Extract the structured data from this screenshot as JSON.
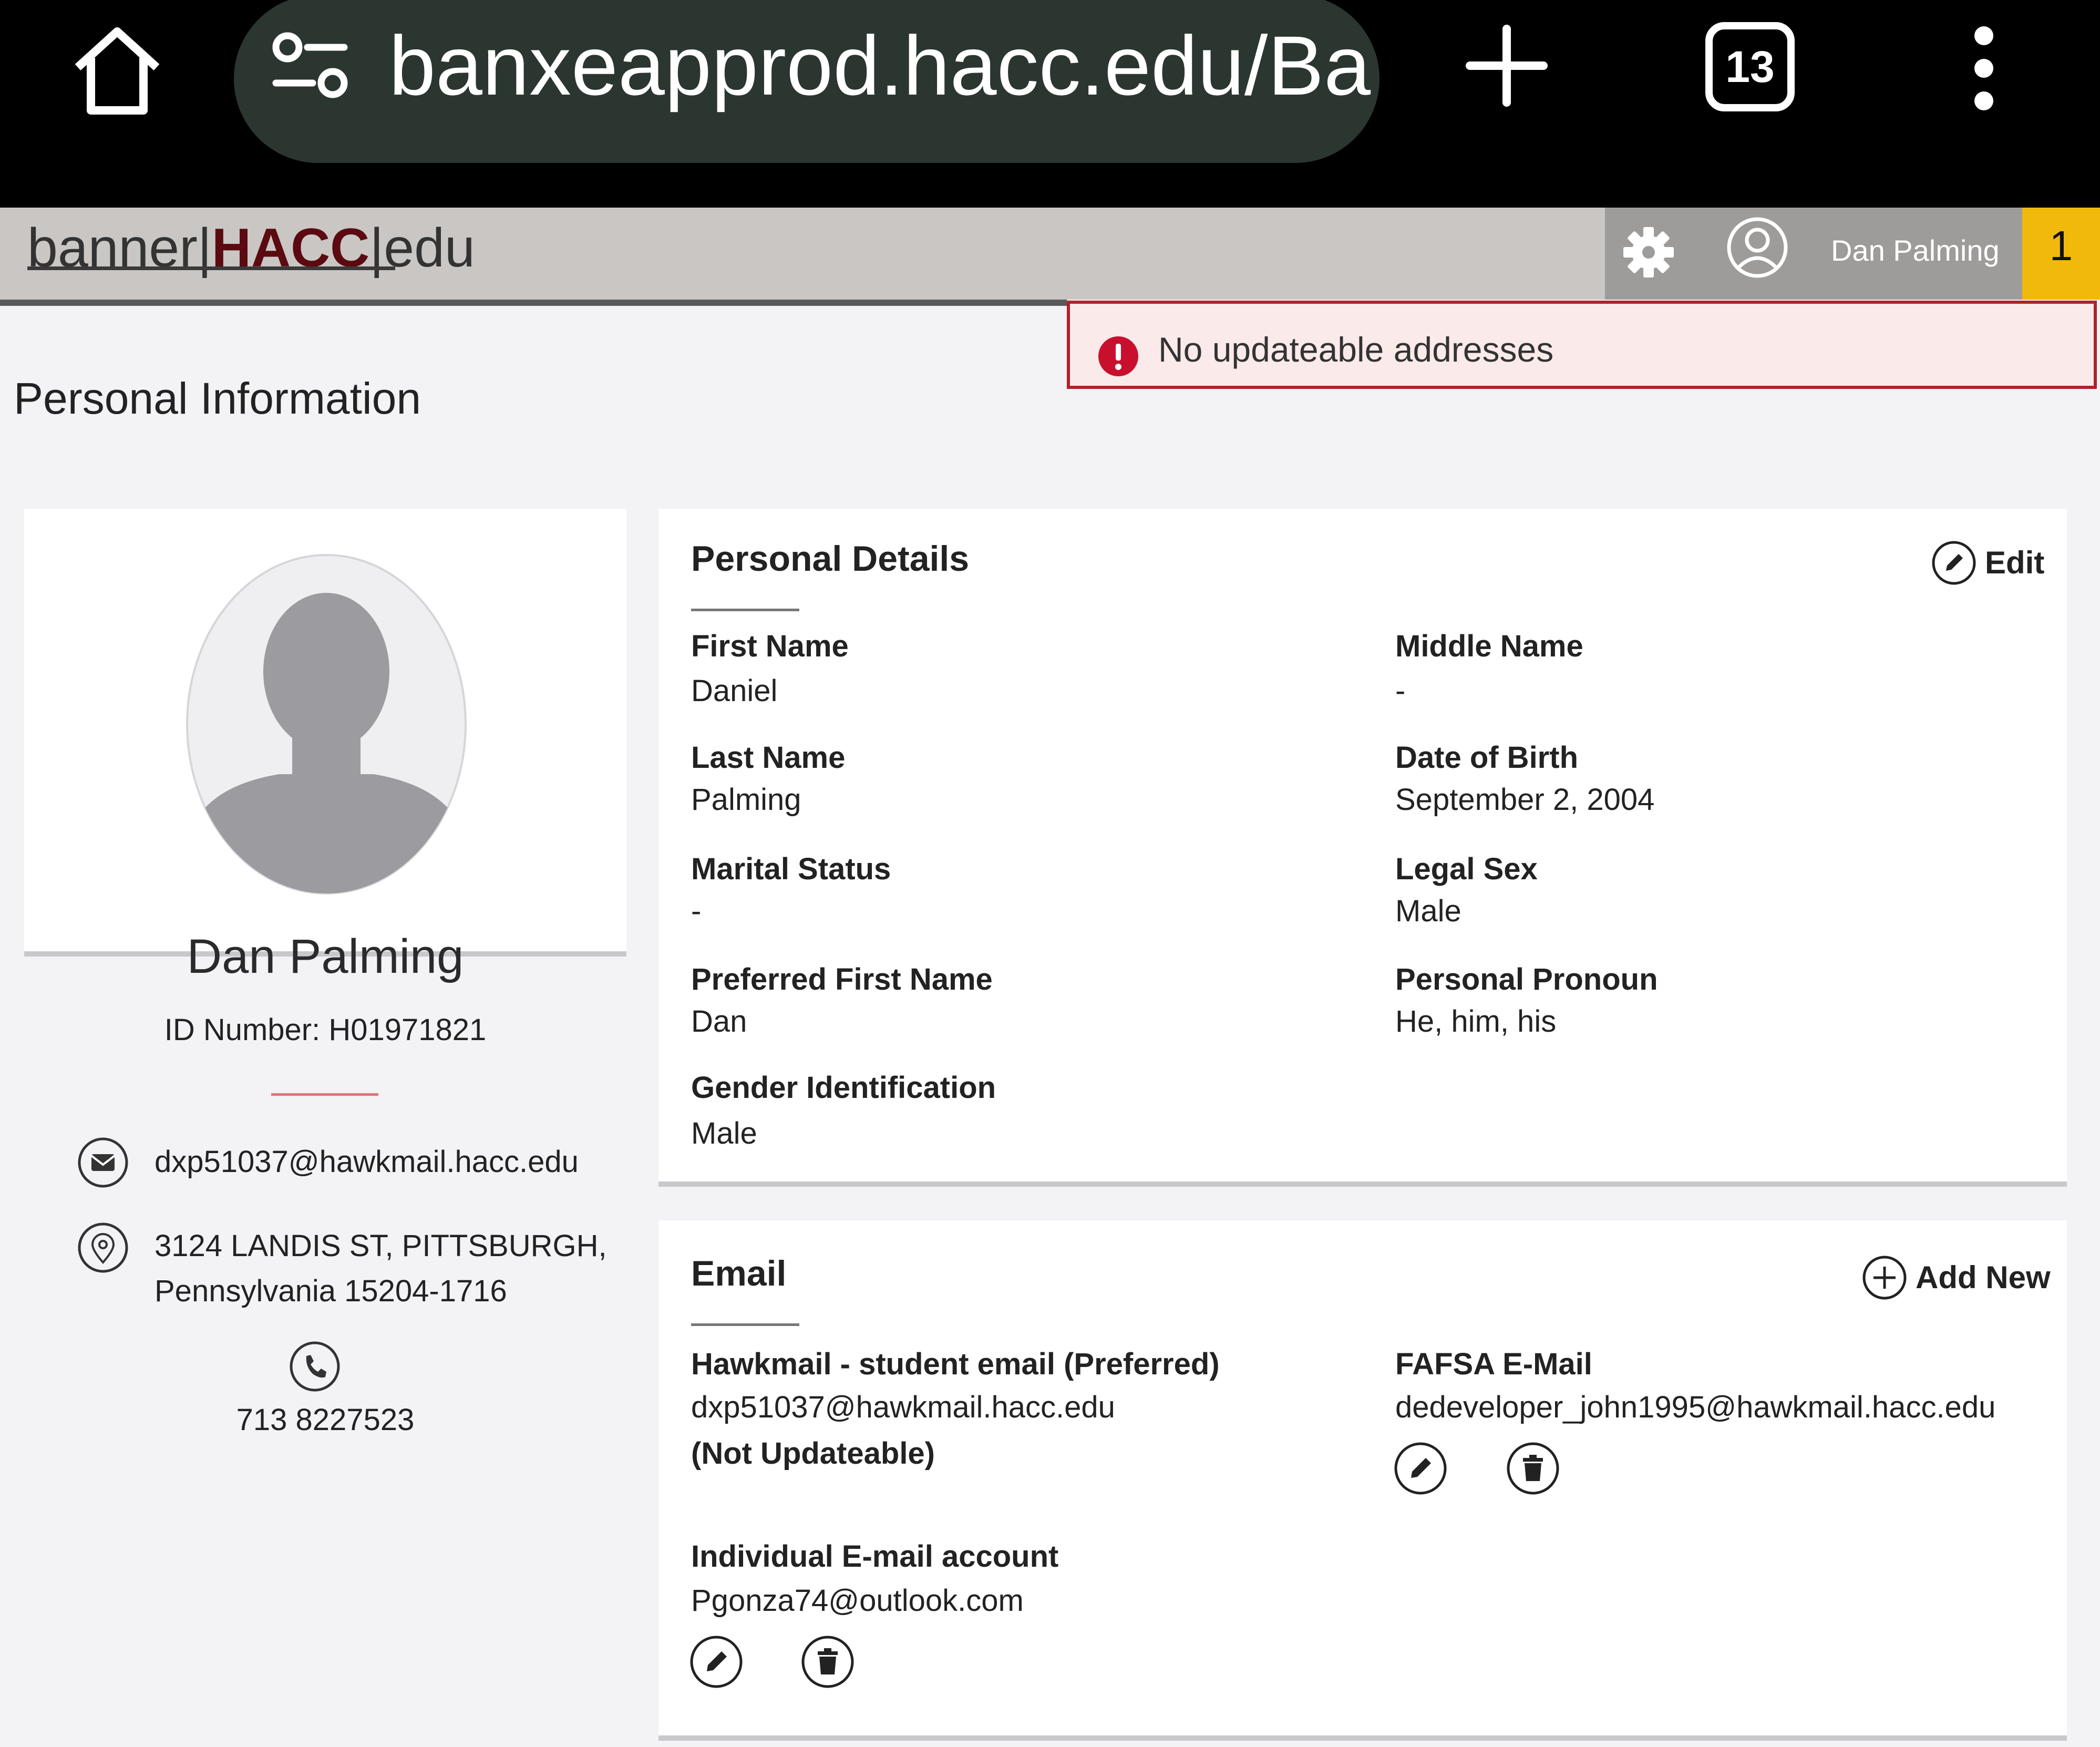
{
  "browser": {
    "url": "banxeapprod.hacc.edu/Ba",
    "tab_count": "13"
  },
  "banner": {
    "logo_left": "banner|",
    "logo_hacc": "HACC",
    "logo_right": "|edu",
    "user_name": "Dan Palming",
    "notification_count": "1"
  },
  "error": {
    "message": "No updateable addresses"
  },
  "page": {
    "title": "Personal Information"
  },
  "profile": {
    "name": "Dan Palming",
    "id_label": "ID Number:",
    "id_value": "H01971821",
    "email": "dxp51037@hawkmail.hacc.edu",
    "address_line1": "3124 LANDIS ST, PITTSBURGH,",
    "address_line2": "Pennsylvania 15204-1716",
    "phone": "713 8227523"
  },
  "personal_details": {
    "title": "Personal Details",
    "edit_label": "Edit",
    "fields": [
      {
        "label": "First Name",
        "value": "Daniel"
      },
      {
        "label": "Middle Name",
        "value": "-"
      },
      {
        "label": "Last Name",
        "value": "Palming"
      },
      {
        "label": "Date of Birth",
        "value": "September 2, 2004"
      },
      {
        "label": "Marital Status",
        "value": "-"
      },
      {
        "label": "Legal Sex",
        "value": "Male"
      },
      {
        "label": "Preferred First Name",
        "value": "Dan"
      },
      {
        "label": "Personal Pronoun",
        "value": "He, him, his"
      },
      {
        "label": "Gender Identification",
        "value": "Male"
      }
    ]
  },
  "email_section": {
    "title": "Email",
    "add_label": "Add New",
    "entries": [
      {
        "type": "Hawkmail - student email (Preferred)",
        "address": "dxp51037@hawkmail.hacc.edu",
        "note": "(Not Updateable)"
      },
      {
        "type": "FAFSA E-Mail",
        "address": "dedeveloper_john1995@hawkmail.hacc.edu"
      },
      {
        "type": "Individual E-mail account",
        "address": "Pgonza74@outlook.com"
      }
    ]
  }
}
